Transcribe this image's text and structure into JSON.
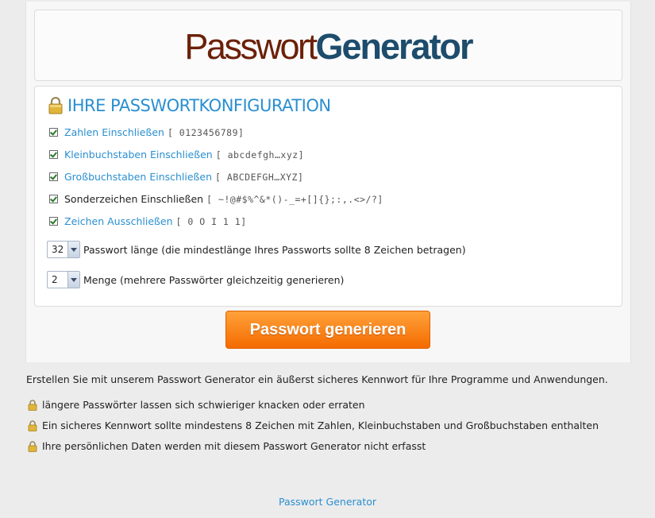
{
  "logo": {
    "part1": "Passwort",
    "part2": "Generator"
  },
  "config": {
    "title": "IHRE PASSWORTKONFIGURATION",
    "options": [
      {
        "label": "Zahlen Einschließen",
        "chars": "[ 0123456789]",
        "checked": true,
        "link": true
      },
      {
        "label": "Kleinbuchstaben Einschließen",
        "chars": "[ abcdefgh…xyz]",
        "checked": true,
        "link": true
      },
      {
        "label": "Großbuchstaben Einschließen",
        "chars": "[ ABCDEFGH…XYZ]",
        "checked": true,
        "link": true
      },
      {
        "label": "Sonderzeichen Einschließen",
        "chars": "[ ~!@#$%^&*()-_=+[]{};:,.<>/?]",
        "checked": true,
        "link": false
      },
      {
        "label": "Zeichen Ausschließen",
        "chars": "[ 0 O I 1 1]",
        "checked": true,
        "link": true
      }
    ],
    "length": {
      "value": "32",
      "label": "Passwort länge (die mindestlänge Ihres Passworts sollte 8 Zeichen betragen)"
    },
    "count": {
      "value": "2",
      "label": "Menge (mehrere Passwörter gleichzeitig generieren)"
    }
  },
  "generate_button": "Passwort generieren",
  "intro": "Erstellen Sie mit unserem Passwort Generator ein äußerst sicheres Kennwort für Ihre Programme und Anwendungen.",
  "bullets": [
    "längere Passwörter lassen sich schwieriger knacken oder erraten",
    "Ein sicheres Kennwort sollte mindestens 8 Zeichen mit Zahlen, Kleinbuchstaben und Großbuchstaben enthalten",
    "Ihre persönlichen Daten werden mit diesem Passwort Generator nicht erfasst"
  ],
  "footer_link": "Passwort Generator",
  "colors": {
    "accent": "#2a8fd0",
    "button": "#f57a00",
    "logo_brown": "#6b2008",
    "logo_blue": "#1d4c6c"
  },
  "icons": {
    "lock": "lock-icon",
    "checkbox": "checkbox-checked",
    "dropdown": "chevron-down-icon"
  }
}
